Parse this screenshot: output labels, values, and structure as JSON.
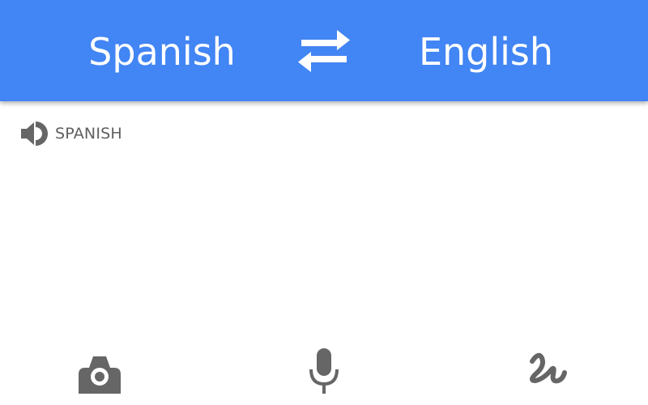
{
  "header": {
    "source_language": "Spanish",
    "target_language": "English",
    "swap_icon": "swap-arrows-icon",
    "background_color": "#4285f4"
  },
  "input": {
    "language_label": "SPANISH",
    "speaker_icon": "speaker-icon"
  },
  "bottom_bar": {
    "icons": [
      "camera-icon",
      "microphone-icon",
      "handwriting-icon"
    ],
    "icon_color": "#666666"
  }
}
